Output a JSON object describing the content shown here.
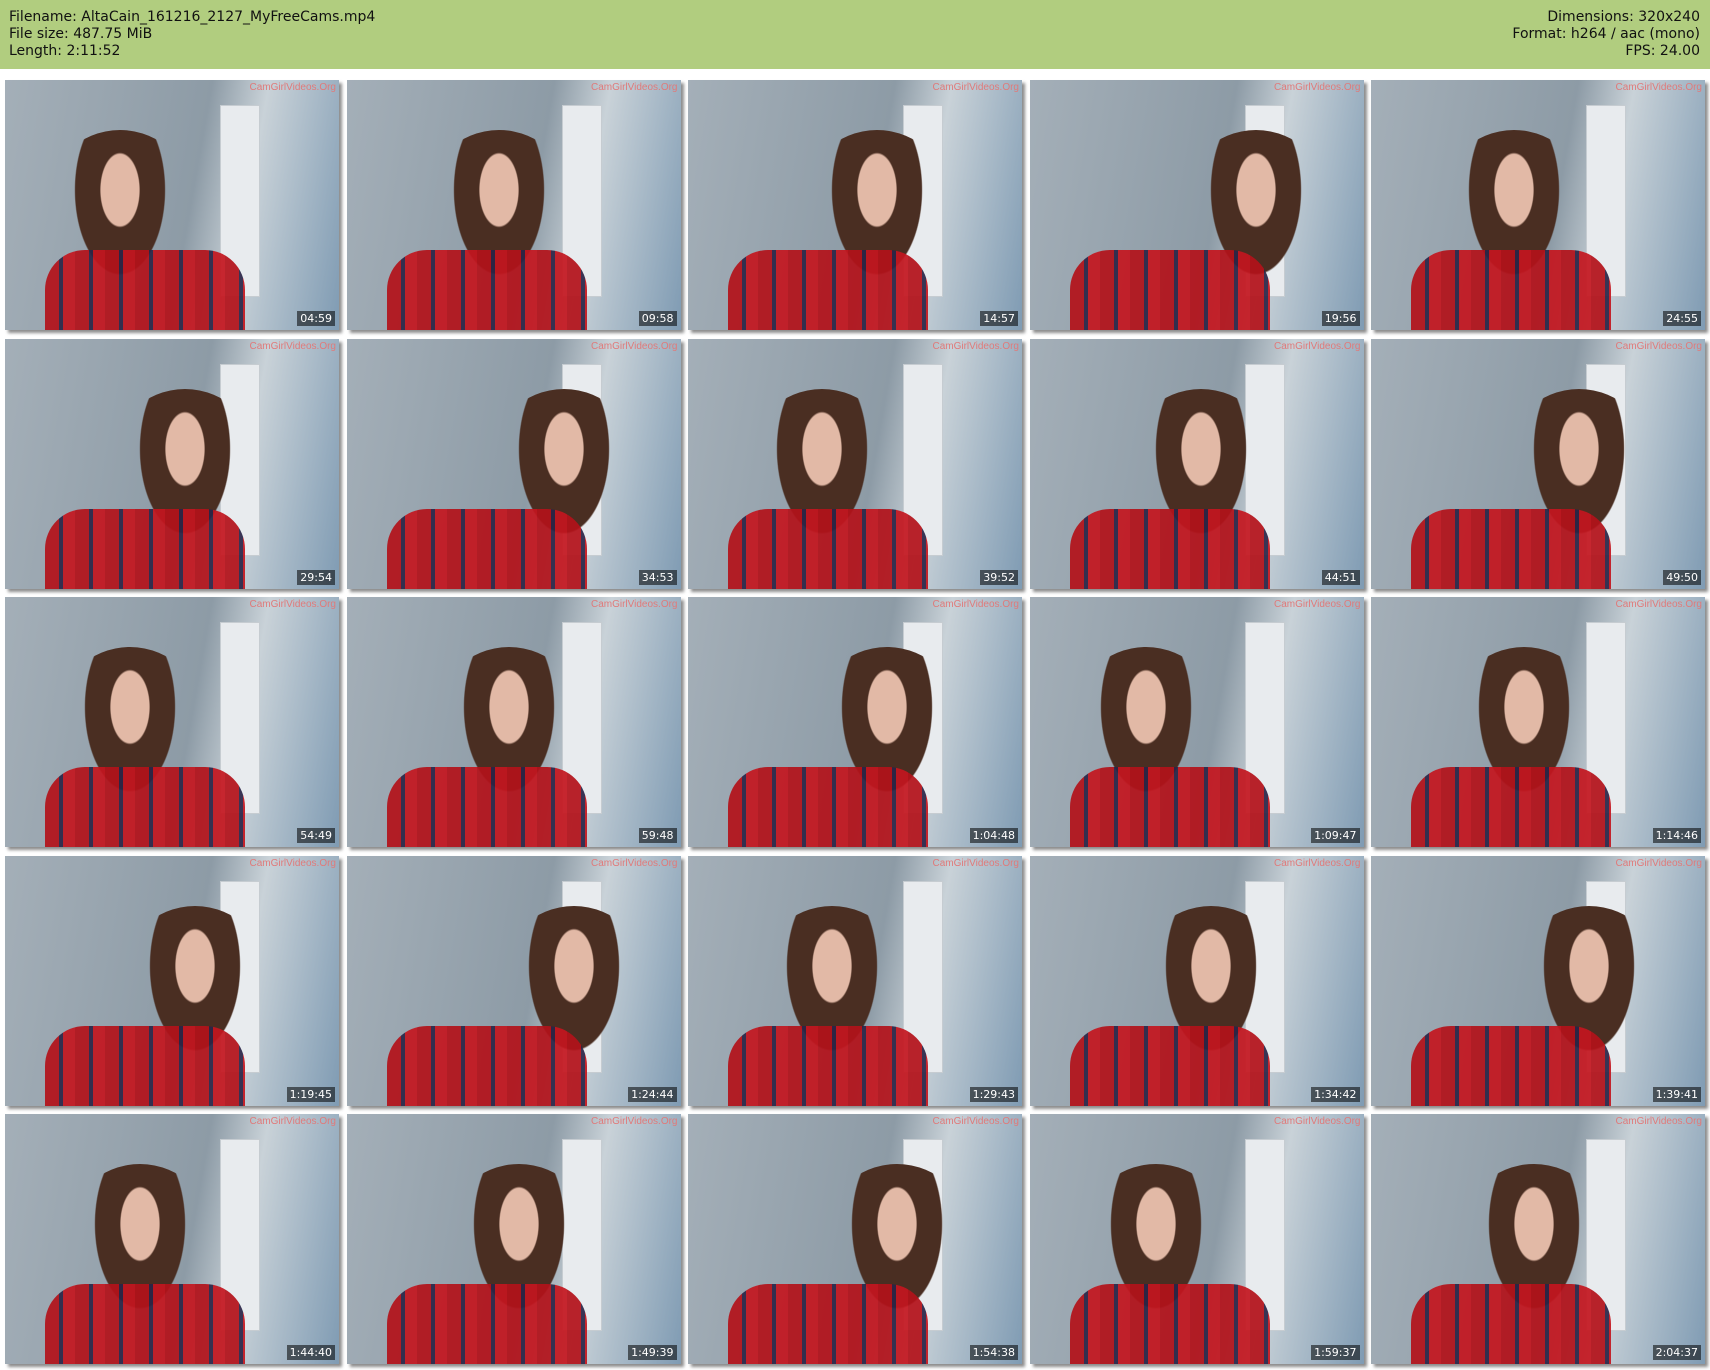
{
  "header": {
    "filename": "Filename: AltaCain_161216_2127_MyFreeCams.mp4",
    "filesize": "File size: 487.75 MiB",
    "length": "Length: 2:11:52",
    "dimensions": "Dimensions: 320x240",
    "format": "Format: h264 / aac (mono)",
    "fps": "FPS: 24.00"
  },
  "watermark": "CamGirlVideos.Org",
  "thumbnails": [
    "04:59",
    "09:58",
    "14:57",
    "19:56",
    "24:55",
    "29:54",
    "34:53",
    "39:52",
    "44:51",
    "49:50",
    "54:49",
    "59:48",
    "1:04:48",
    "1:09:47",
    "1:14:46",
    "1:19:45",
    "1:24:44",
    "1:29:43",
    "1:34:42",
    "1:39:41",
    "1:44:40",
    "1:49:39",
    "1:54:38",
    "1:59:37",
    "2:04:37"
  ]
}
